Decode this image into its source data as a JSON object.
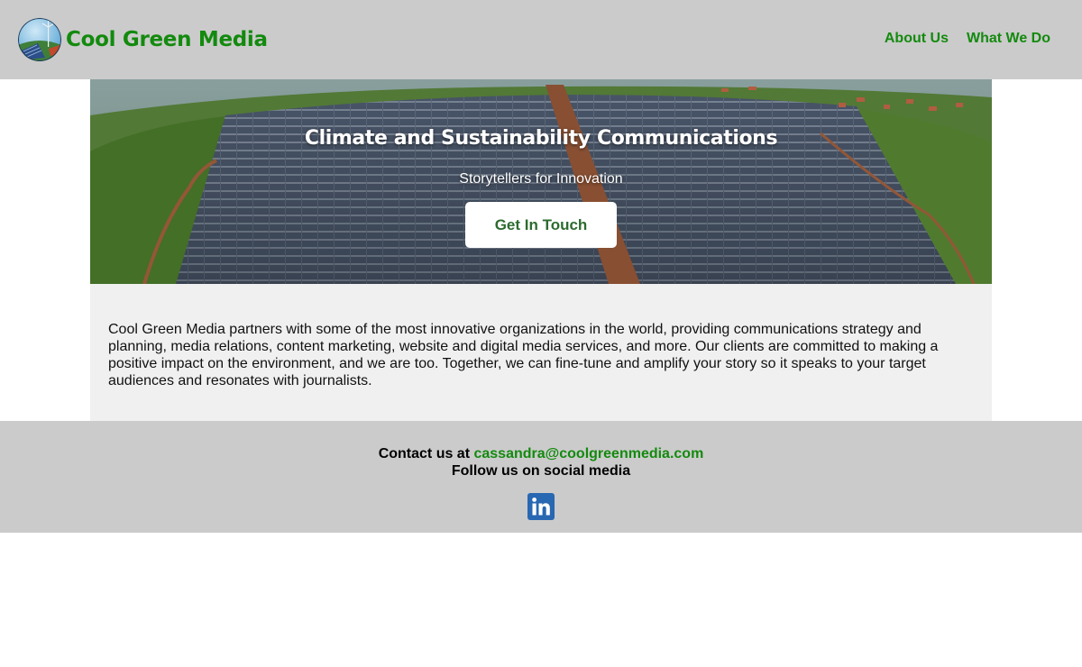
{
  "header": {
    "brand": "Cool Green Media",
    "nav": [
      {
        "label": "About Us"
      },
      {
        "label": "What We Do"
      }
    ]
  },
  "hero": {
    "title": "Climate and Sustainability Communications",
    "subtitle": "Storytellers for Innovation",
    "cta_label": "Get In Touch"
  },
  "about": {
    "text": "Cool Green Media partners with some of the most innovative organizations in the world, providing communications strategy and planning, media relations, content marketing, website and digital media services, and more. Our clients are committed to making a positive impact on the environment, and we are too. Together, we can fine-tune and amplify your story so it speaks to your target audiences and resonates with journalists."
  },
  "footer": {
    "contact_prefix": "Contact us at",
    "email": "cassandra@coolgreenmedia.com",
    "follow_text": "Follow us on social media",
    "social_icon": "linkedin-icon"
  },
  "colors": {
    "brand_green": "#138a0e",
    "header_bg": "#cbcbcb",
    "about_bg": "#f0f0f0",
    "linkedin_blue": "#2867b2"
  }
}
